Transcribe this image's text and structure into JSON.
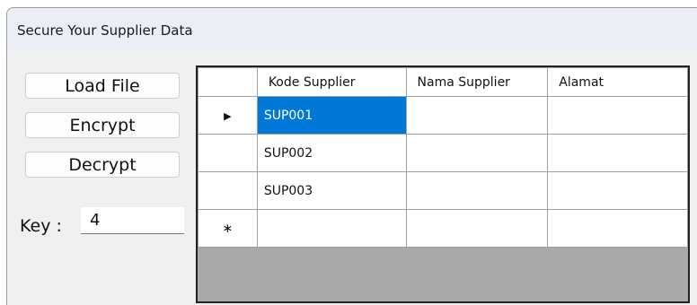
{
  "window": {
    "title": "Secure Your Supplier Data"
  },
  "buttons": {
    "load": "Load File",
    "encrypt": "Encrypt",
    "decrypt": "Decrypt"
  },
  "key": {
    "label": "Key :",
    "value": "4"
  },
  "grid": {
    "columns": [
      "Kode Supplier",
      "Nama Supplier",
      "Alamat"
    ],
    "rows": [
      {
        "indicator": "current-row-arrow",
        "kode": "SUP001",
        "nama": "",
        "alamat": "",
        "selected": true
      },
      {
        "indicator": "",
        "kode": "SUP002",
        "nama": "",
        "alamat": ""
      },
      {
        "indicator": "",
        "kode": "SUP003",
        "nama": "",
        "alamat": ""
      },
      {
        "indicator": "new-row-star",
        "kode": "",
        "nama": "",
        "alamat": ""
      }
    ],
    "selection_color": "#0078d7"
  }
}
